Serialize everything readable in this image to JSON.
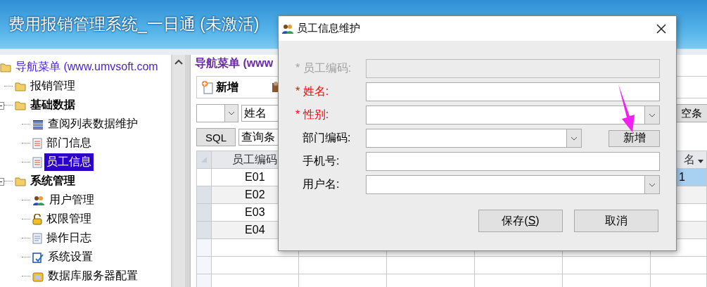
{
  "window": {
    "title": "费用报销管理系统_一日通 (未激活)"
  },
  "nav_tree": {
    "label": "导航菜单 (www.umvsoft.com",
    "kind": "root",
    "selected": false,
    "children": [
      {
        "label": "报销管理",
        "kind": "folder",
        "selected": false
      },
      {
        "label": "基础数据",
        "kind": "folder",
        "expanded": true,
        "selected": false,
        "children": [
          {
            "label": "查阅列表数据维护",
            "kind": "grid",
            "selected": false
          },
          {
            "label": "部门信息",
            "kind": "document",
            "selected": false
          },
          {
            "label": "员工信息",
            "kind": "document",
            "selected": true
          }
        ]
      },
      {
        "label": "系统管理",
        "kind": "folder",
        "expanded": true,
        "selected": false,
        "children": [
          {
            "label": "用户管理",
            "kind": "users",
            "selected": false
          },
          {
            "label": "权限管理",
            "kind": "lock",
            "selected": false
          },
          {
            "label": "操作日志",
            "kind": "log",
            "selected": false
          },
          {
            "label": "系统设置",
            "kind": "settings",
            "selected": false
          },
          {
            "label": "数据库服务器配置",
            "kind": "database",
            "selected": false
          }
        ]
      }
    ]
  },
  "panel": {
    "title": "导航菜单 (www",
    "toolbar": [
      {
        "label": "新增",
        "kind": "add"
      },
      {
        "kind": "tool"
      }
    ],
    "filter": {
      "field_value": "姓名",
      "clear_button": "空条"
    },
    "sql_button": "SQL",
    "query_value": "查询条",
    "grid": {
      "first_column": "员工编码",
      "last_column": "名",
      "rows": [
        {
          "code": "E01",
          "last": "1",
          "selected": true
        },
        {
          "code": "E02",
          "selected": false
        },
        {
          "code": "E03",
          "selected": false
        },
        {
          "code": "E04",
          "selected": false
        }
      ]
    }
  },
  "dialog": {
    "title": "员工信息维护",
    "fields": [
      {
        "label": "* 员工编码:",
        "kind": "text",
        "required": true,
        "disabled": true
      },
      {
        "label": "* 姓名:",
        "kind": "text",
        "required": true,
        "disabled": false
      },
      {
        "label": "* 性别:",
        "kind": "select",
        "required": true,
        "disabled": false
      },
      {
        "label": "部门编码:",
        "kind": "select",
        "required": false,
        "disabled": false,
        "button": "新增"
      },
      {
        "label": "手机号:",
        "kind": "text",
        "required": false,
        "disabled": false
      },
      {
        "label": "用户名:",
        "kind": "select",
        "required": false,
        "disabled": false
      }
    ],
    "buttons": [
      {
        "label": "保存(",
        "access_key": "S",
        "suffix": ")"
      },
      {
        "label": "取消"
      }
    ]
  }
}
